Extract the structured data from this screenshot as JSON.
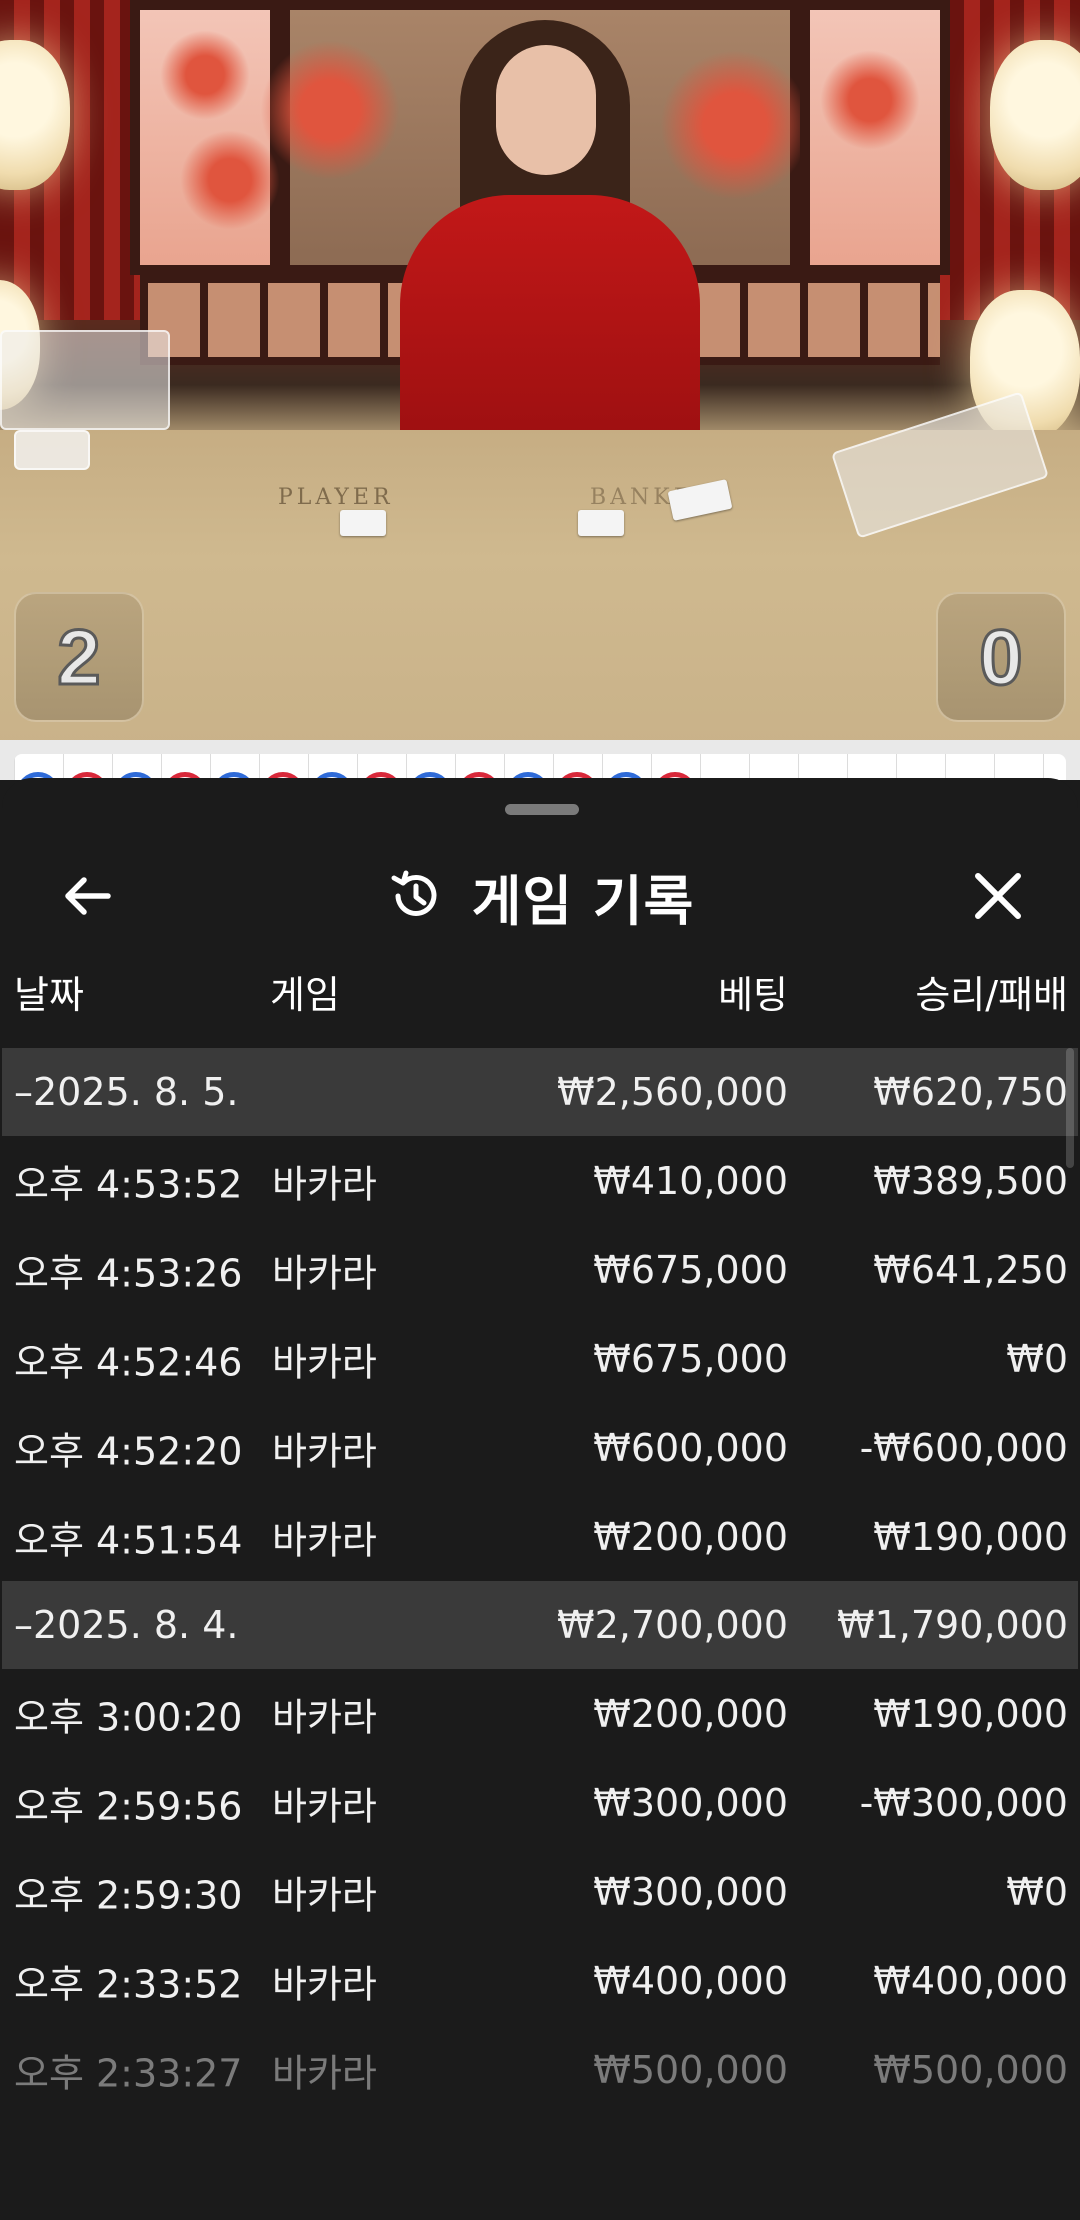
{
  "video": {
    "felt_player_label": "PLAYER",
    "felt_banker_label": "BANKER",
    "player_score": "2",
    "banker_score": "0"
  },
  "bead_road": [
    "P",
    "B",
    "P",
    "B",
    "P",
    "B",
    "P",
    "B",
    "P",
    "B",
    "P",
    "B",
    "P",
    "B"
  ],
  "sheet": {
    "title": "게임 기록",
    "columns": {
      "date": "날짜",
      "game": "게임",
      "bet": "베팅",
      "win_loss": "승리/패배"
    },
    "rows": [
      {
        "type": "date",
        "date": "–2025. 8. 5.",
        "game": "",
        "bet": "₩2,560,000",
        "win_loss": "₩620,750"
      },
      {
        "type": "item",
        "date": "오후 4:53:52",
        "game": "바카라",
        "bet": "₩410,000",
        "win_loss": "₩389,500"
      },
      {
        "type": "item",
        "date": "오후 4:53:26",
        "game": "바카라",
        "bet": "₩675,000",
        "win_loss": "₩641,250"
      },
      {
        "type": "item",
        "date": "오후 4:52:46",
        "game": "바카라",
        "bet": "₩675,000",
        "win_loss": "₩0"
      },
      {
        "type": "item",
        "date": "오후 4:52:20",
        "game": "바카라",
        "bet": "₩600,000",
        "win_loss": "-₩600,000"
      },
      {
        "type": "item",
        "date": "오후 4:51:54",
        "game": "바카라",
        "bet": "₩200,000",
        "win_loss": "₩190,000"
      },
      {
        "type": "date",
        "date": "–2025. 8. 4.",
        "game": "",
        "bet": "₩2,700,000",
        "win_loss": "₩1,790,000"
      },
      {
        "type": "item",
        "date": "오후 3:00:20",
        "game": "바카라",
        "bet": "₩200,000",
        "win_loss": "₩190,000"
      },
      {
        "type": "item",
        "date": "오후 2:59:56",
        "game": "바카라",
        "bet": "₩300,000",
        "win_loss": "-₩300,000"
      },
      {
        "type": "item",
        "date": "오후 2:59:30",
        "game": "바카라",
        "bet": "₩300,000",
        "win_loss": "₩0"
      },
      {
        "type": "item",
        "date": "오후 2:33:52",
        "game": "바카라",
        "bet": "₩400,000",
        "win_loss": "₩400,000"
      },
      {
        "type": "item",
        "date": "오후 2:33:27",
        "game": "바카라",
        "bet": "₩500,000",
        "win_loss": "₩500,000"
      }
    ]
  },
  "colors": {
    "sheet_bg": "#1b1b1b",
    "date_row_bg": "#3a3a3a",
    "bead_player": "#2f6bd8",
    "bead_banker": "#d8283a"
  },
  "icons": {
    "back": "arrow-left-icon",
    "history": "history-icon",
    "close": "close-icon"
  }
}
